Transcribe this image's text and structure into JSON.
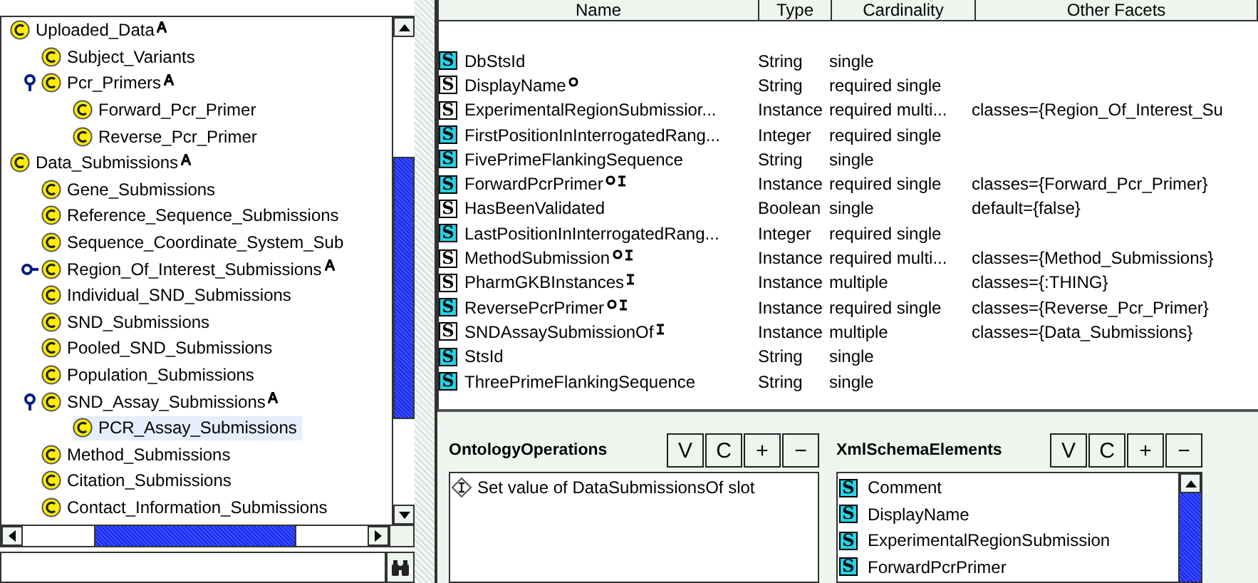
{
  "class_tree": [
    {
      "label": "Uploaded_Data",
      "abstract": true,
      "selected": false,
      "children": [
        {
          "label": "Subject_Variants",
          "abstract": false,
          "selected": false
        },
        {
          "label": "Pcr_Primers",
          "abstract": true,
          "selected": false,
          "expanded": true,
          "children": [
            {
              "label": "Forward_Pcr_Primer",
              "abstract": false,
              "selected": false
            },
            {
              "label": "Reverse_Pcr_Primer",
              "abstract": false,
              "selected": false
            }
          ]
        }
      ]
    },
    {
      "label": "Data_Submissions",
      "abstract": true,
      "selected": false,
      "children": [
        {
          "label": "Gene_Submissions",
          "abstract": false,
          "selected": false
        },
        {
          "label": "Reference_Sequence_Submissions",
          "abstract": false,
          "selected": false
        },
        {
          "label": "Sequence_Coordinate_System_Sub",
          "abstract": false,
          "selected": false
        },
        {
          "label": "Region_Of_Interest_Submissions",
          "abstract": true,
          "selected": false,
          "expanded": false
        },
        {
          "label": "Individual_SND_Submissions",
          "abstract": false,
          "selected": false
        },
        {
          "label": "SND_Submissions",
          "abstract": false,
          "selected": false
        },
        {
          "label": "Pooled_SND_Submissions",
          "abstract": false,
          "selected": false
        },
        {
          "label": "Population_Submissions",
          "abstract": false,
          "selected": false
        },
        {
          "label": "SND_Assay_Submissions",
          "abstract": true,
          "selected": false,
          "expanded": true,
          "children": [
            {
              "label": "PCR_Assay_Submissions",
              "abstract": false,
              "selected": true
            }
          ]
        },
        {
          "label": "Method_Submissions",
          "abstract": false,
          "selected": false
        },
        {
          "label": "Citation_Submissions",
          "abstract": false,
          "selected": false
        },
        {
          "label": "Contact_Information_Submissions",
          "abstract": false,
          "selected": false
        }
      ]
    }
  ],
  "slot_table": {
    "columns": [
      "Name",
      "Type",
      "Cardinality",
      "Other Facets"
    ],
    "rows": [
      {
        "icon": "S",
        "name": "DbStsId",
        "own": true,
        "overridden": false,
        "inverse": false,
        "type": "String",
        "cardinality": "single",
        "other": ""
      },
      {
        "icon": "S",
        "name": "DisplayName",
        "own": false,
        "overridden": true,
        "inverse": false,
        "type": "String",
        "cardinality": "required single",
        "other": ""
      },
      {
        "icon": "S",
        "name": "ExperimentalRegionSubmissior...",
        "own": false,
        "overridden": false,
        "inverse": false,
        "type": "Instance",
        "cardinality": "required multi...",
        "other": "classes={Region_Of_Interest_Su"
      },
      {
        "icon": "S",
        "name": "FirstPositionInInterrogatedRang...",
        "own": true,
        "overridden": false,
        "inverse": false,
        "type": "Integer",
        "cardinality": "required single",
        "other": ""
      },
      {
        "icon": "S",
        "name": "FivePrimeFlankingSequence",
        "own": true,
        "overridden": false,
        "inverse": false,
        "type": "String",
        "cardinality": "single",
        "other": ""
      },
      {
        "icon": "S",
        "name": "ForwardPcrPrimer",
        "own": true,
        "overridden": true,
        "inverse": true,
        "type": "Instance",
        "cardinality": "required single",
        "other": "classes={Forward_Pcr_Primer}"
      },
      {
        "icon": "S",
        "name": "HasBeenValidated",
        "own": false,
        "overridden": false,
        "inverse": false,
        "type": "Boolean",
        "cardinality": "single",
        "other": "default={false}"
      },
      {
        "icon": "S",
        "name": "LastPositionInInterrogatedRang...",
        "own": true,
        "overridden": false,
        "inverse": false,
        "type": "Integer",
        "cardinality": "required single",
        "other": ""
      },
      {
        "icon": "S",
        "name": "MethodSubmission",
        "own": false,
        "overridden": true,
        "inverse": true,
        "type": "Instance",
        "cardinality": "required multi...",
        "other": "classes={Method_Submissions}"
      },
      {
        "icon": "S",
        "name": "PharmGKBInstances",
        "own": false,
        "overridden": false,
        "inverse": true,
        "type": "Instance",
        "cardinality": "multiple",
        "other": "classes={:THING}"
      },
      {
        "icon": "S",
        "name": "ReversePcrPrimer",
        "own": true,
        "overridden": true,
        "inverse": true,
        "type": "Instance",
        "cardinality": "required single",
        "other": "classes={Reverse_Pcr_Primer}"
      },
      {
        "icon": "S",
        "name": "SNDAssaySubmissionOf",
        "own": false,
        "overridden": false,
        "inverse": true,
        "type": "Instance",
        "cardinality": "multiple",
        "other": "classes={Data_Submissions}"
      },
      {
        "icon": "S",
        "name": "StsId",
        "own": true,
        "overridden": false,
        "inverse": false,
        "type": "String",
        "cardinality": "single",
        "other": ""
      },
      {
        "icon": "S",
        "name": "ThreePrimeFlankingSequence",
        "own": true,
        "overridden": false,
        "inverse": false,
        "type": "String",
        "cardinality": "single",
        "other": ""
      }
    ]
  },
  "panels": [
    {
      "title": "OntologyOperations",
      "buttons": [
        "V",
        "C",
        "+",
        "−"
      ],
      "kind": "operations",
      "items": [
        {
          "label": "Set value of DataSubmissionsOf slot"
        }
      ]
    },
    {
      "title": "XmlSchemaElements",
      "buttons": [
        "V",
        "C",
        "+",
        "−"
      ],
      "kind": "elements",
      "items": [
        {
          "icon": "S",
          "label": "Comment"
        },
        {
          "icon": "S",
          "label": "DisplayName"
        },
        {
          "icon": "S",
          "label": "ExperimentalRegionSubmission"
        },
        {
          "icon": "S",
          "label": "ForwardPcrPrimer"
        }
      ]
    }
  ]
}
